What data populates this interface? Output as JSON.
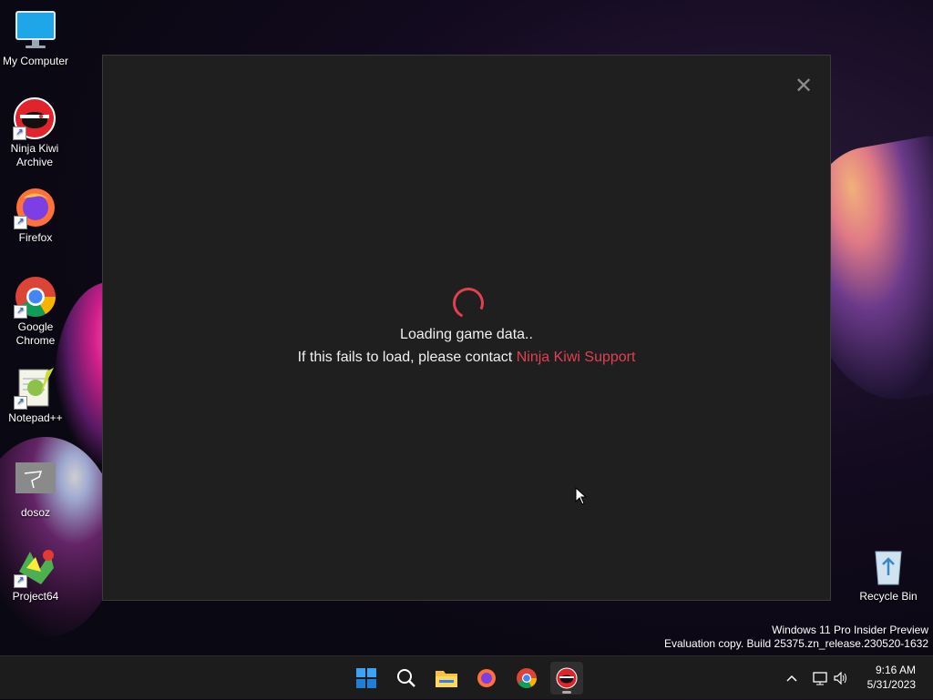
{
  "desktop": {
    "icons": [
      {
        "label": "My Computer"
      },
      {
        "label": "Ninja Kiwi Archive"
      },
      {
        "label": "Firefox"
      },
      {
        "label": "Google Chrome"
      },
      {
        "label": "Notepad++"
      },
      {
        "label": "dosoz"
      },
      {
        "label": "Project64"
      },
      {
        "label": "Recycle Bin"
      }
    ]
  },
  "app": {
    "close_glyph": "✕",
    "loading_text": "Loading game data..",
    "fail_text": "If this fails to load, please contact ",
    "support_link": "Ninja Kiwi Support",
    "accent_color": "#e0404f"
  },
  "watermark": {
    "line1": "Windows 11 Pro Insider Preview",
    "line2": "Evaluation copy. Build 25375.zn_release.230520-1632"
  },
  "taskbar": {
    "apps": [
      "start-icon",
      "search-icon",
      "file-explorer-icon",
      "firefox-icon",
      "chrome-icon",
      "ninja-kiwi-icon"
    ],
    "clock": {
      "time": "9:16 AM",
      "date": "5/31/2023"
    }
  }
}
